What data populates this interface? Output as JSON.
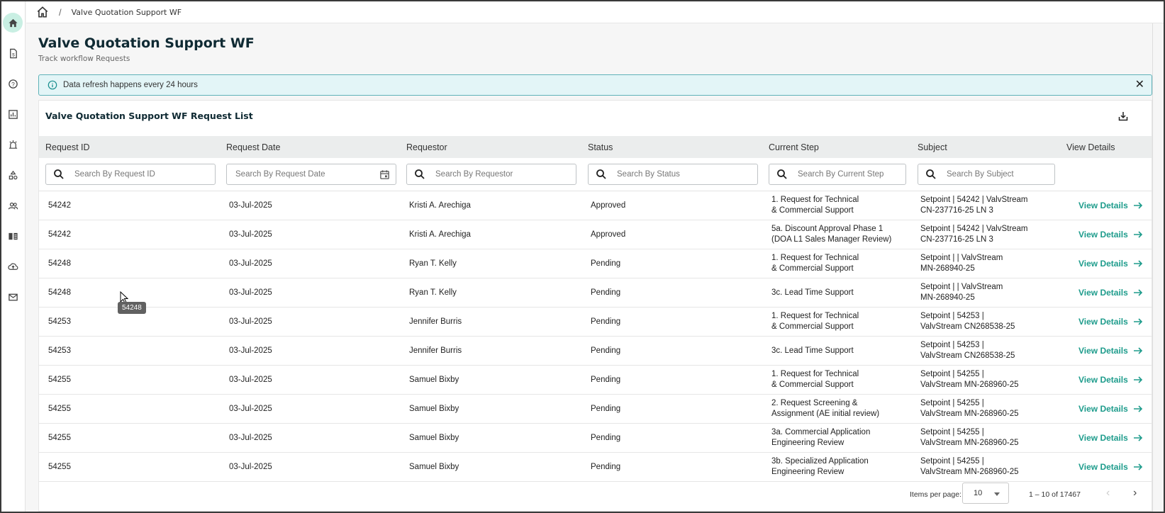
{
  "breadcrumb": {
    "current": "Valve Quotation Support WF"
  },
  "page": {
    "title": "Valve Quotation Support WF",
    "subtitle": "Track workflow Requests"
  },
  "banner": {
    "text": "Data refresh happens every 24 hours",
    "close": "✕"
  },
  "table": {
    "title": "Valve Quotation Support WF Request List",
    "columns": [
      "Request ID",
      "Request Date",
      "Requestor",
      "Status",
      "Current Step",
      "Subject",
      "View Details"
    ],
    "placeholders": {
      "id": "Search By Request ID",
      "date": "Search By Request Date",
      "requestor": "Search By Requestor",
      "status": "Search By Status",
      "step": "Search By Current Step",
      "subject": "Search By Subject"
    },
    "view_label": "View Details",
    "rows": [
      {
        "id": "54242",
        "date": "03-Jul-2025",
        "requestor": "Kristi A. Arechiga",
        "status": "Approved",
        "step1": "1. Request for Technical",
        "step2": "& Commercial Support",
        "subj1": "Setpoint | 54242 | ValvStream",
        "subj2": "CN-237716-25 LN 3"
      },
      {
        "id": "54242",
        "date": "03-Jul-2025",
        "requestor": "Kristi A. Arechiga",
        "status": "Approved",
        "step1": "5a. Discount Approval Phase 1",
        "step2": "(DOA L1 Sales Manager Review)",
        "subj1": "Setpoint | 54242 | ValvStream",
        "subj2": "CN-237716-25 LN 3"
      },
      {
        "id": "54248",
        "date": "03-Jul-2025",
        "requestor": "Ryan T. Kelly",
        "status": "Pending",
        "step1": "1. Request for Technical",
        "step2": "& Commercial Support",
        "subj1": "Setpoint | | ValvStream",
        "subj2": "MN-268940-25"
      },
      {
        "id": "54248",
        "date": "03-Jul-2025",
        "requestor": "Ryan T. Kelly",
        "status": "Pending",
        "step1": "3c. Lead Time Support",
        "step2": "",
        "subj1": "Setpoint | | ValvStream",
        "subj2": "MN-268940-25"
      },
      {
        "id": "54253",
        "date": "03-Jul-2025",
        "requestor": "Jennifer Burris",
        "status": "Pending",
        "step1": "1. Request for Technical",
        "step2": "& Commercial Support",
        "subj1": "Setpoint | 54253 |",
        "subj2": "ValvStream CN268538-25"
      },
      {
        "id": "54253",
        "date": "03-Jul-2025",
        "requestor": "Jennifer Burris",
        "status": "Pending",
        "step1": "3c. Lead Time Support",
        "step2": "",
        "subj1": "Setpoint | 54253 |",
        "subj2": "ValvStream CN268538-25"
      },
      {
        "id": "54255",
        "date": "03-Jul-2025",
        "requestor": "Samuel Bixby",
        "status": "Pending",
        "step1": "1. Request for Technical",
        "step2": "& Commercial Support",
        "subj1": "Setpoint | 54255 |",
        "subj2": "ValvStream MN-268960-25"
      },
      {
        "id": "54255",
        "date": "03-Jul-2025",
        "requestor": "Samuel Bixby",
        "status": "Pending",
        "step1": "2. Request Screening &",
        "step2": "Assignment (AE initial review)",
        "subj1": "Setpoint | 54255 |",
        "subj2": "ValvStream MN-268960-25"
      },
      {
        "id": "54255",
        "date": "03-Jul-2025",
        "requestor": "Samuel Bixby",
        "status": "Pending",
        "step1": "3a. Commercial Application",
        "step2": "Engineering Review",
        "subj1": "Setpoint | 54255 |",
        "subj2": "ValvStream MN-268960-25"
      },
      {
        "id": "54255",
        "date": "03-Jul-2025",
        "requestor": "Samuel Bixby",
        "status": "Pending",
        "step1": "3b. Specialized Application",
        "step2": "Engineering Review",
        "subj1": "Setpoint | 54255 |",
        "subj2": "ValvStream MN-268960-25"
      }
    ]
  },
  "pagination": {
    "items_per_page_label": "Items per page:",
    "items_per_page": "10",
    "range": "1 – 10 of 17467",
    "prev": "‹",
    "next": "›"
  },
  "tooltip": "54248",
  "colors": {
    "accent": "#1e9c8c",
    "banner_bg": "#e3f5f7",
    "active_nav": "#c9efe3"
  }
}
